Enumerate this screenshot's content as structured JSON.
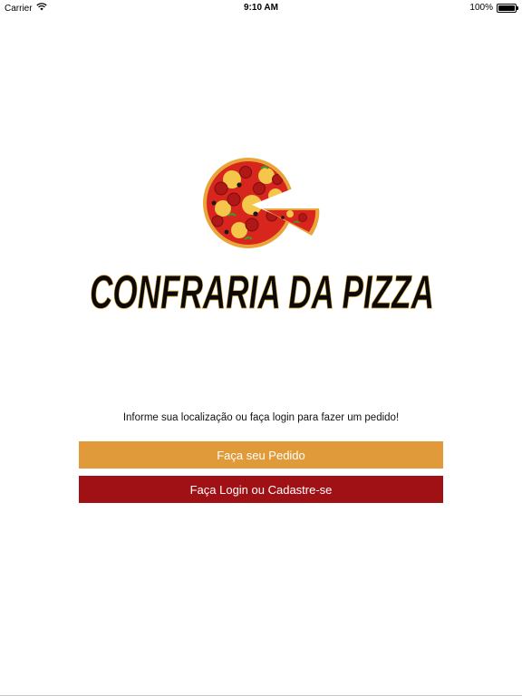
{
  "status_bar": {
    "carrier": "Carrier",
    "time": "9:10 AM",
    "battery": "100%",
    "battery_level": 1.0,
    "wifi_icon": "wifi-icon",
    "battery_icon": "battery-icon"
  },
  "logo": {
    "brand_text": "CONFRARIA DA PIZZA",
    "pizza_icon": "pizza-icon"
  },
  "main": {
    "info_text": "Informe sua localização ou faça login para fazer um pedido!",
    "order_button_label": "Faça seu Pedido",
    "login_button_label": "Faça Login ou Cadastre-se"
  },
  "colors": {
    "order_button": "#e09a3a",
    "login_button": "#a01116",
    "pizza_sauce": "#d8251e",
    "pizza_crust": "#f0b040"
  }
}
